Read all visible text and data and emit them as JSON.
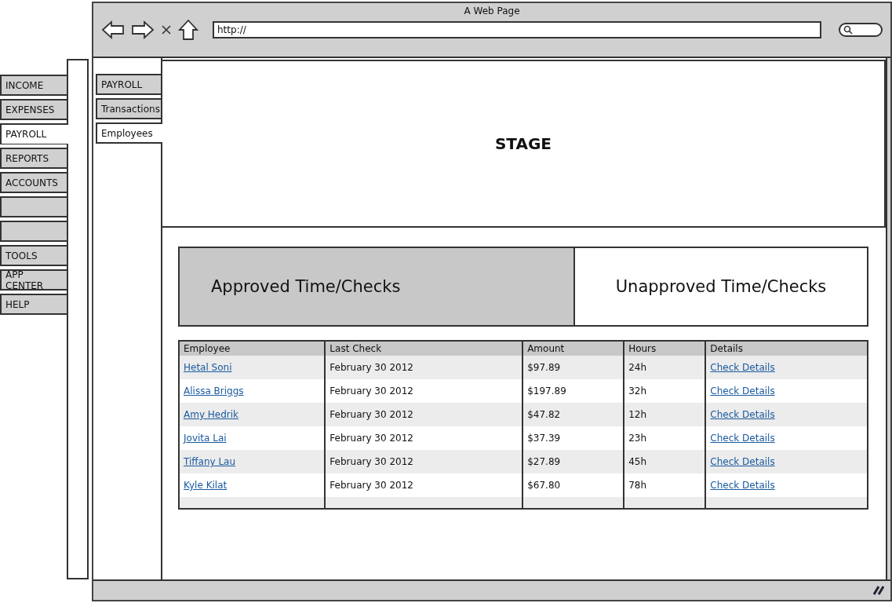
{
  "main_nav": {
    "items": [
      {
        "label": "INCOME",
        "selected": false
      },
      {
        "label": "EXPENSES",
        "selected": false
      },
      {
        "label": "PAYROLL",
        "selected": true
      },
      {
        "label": "REPORTS",
        "selected": false
      },
      {
        "label": "ACCOUNTS",
        "selected": false
      },
      {
        "selected": false
      },
      {
        "selected": false
      },
      {
        "label": "TOOLS",
        "selected": false
      },
      {
        "label": "APP CENTER",
        "selected": false
      },
      {
        "label": "HELP",
        "selected": false
      }
    ]
  },
  "window": {
    "title": "A Web Page",
    "address": "http://"
  },
  "sub_nav": {
    "items": [
      {
        "label": "PAYROLL",
        "selected": false
      },
      {
        "label": "Transactions",
        "selected": false
      },
      {
        "label": "Employees",
        "selected": true
      }
    ]
  },
  "stage": {
    "label": "STAGE"
  },
  "toggle": [
    {
      "label": "Approved Time/Checks",
      "selected": true
    },
    {
      "label": "Unapproved Time/Checks",
      "selected": false
    }
  ],
  "table": {
    "columns": [
      "Employee",
      "Last Check",
      "Amount",
      "Hours",
      "Details"
    ],
    "rows": [
      [
        "Hetal Soni",
        "February 30 2012",
        "$97.89",
        "24h",
        "Check Details"
      ],
      [
        "Alissa Briggs",
        "February 30 2012",
        "$197.89",
        "32h",
        "Check Details"
      ],
      [
        "Amy Hedrik",
        "February 30 2012",
        "$47.82",
        "12h",
        "Check Details"
      ],
      [
        "Jovita Lai",
        "February 30 2012",
        "$37.39",
        "23h",
        "Check Details"
      ],
      [
        "Tiffany Lau",
        "February 30 2012",
        "$27.89",
        "45h",
        "Check Details"
      ],
      [
        "Kyle Kilat",
        "February 30 2012",
        "$67.80",
        "78h",
        "Check Details"
      ]
    ]
  }
}
